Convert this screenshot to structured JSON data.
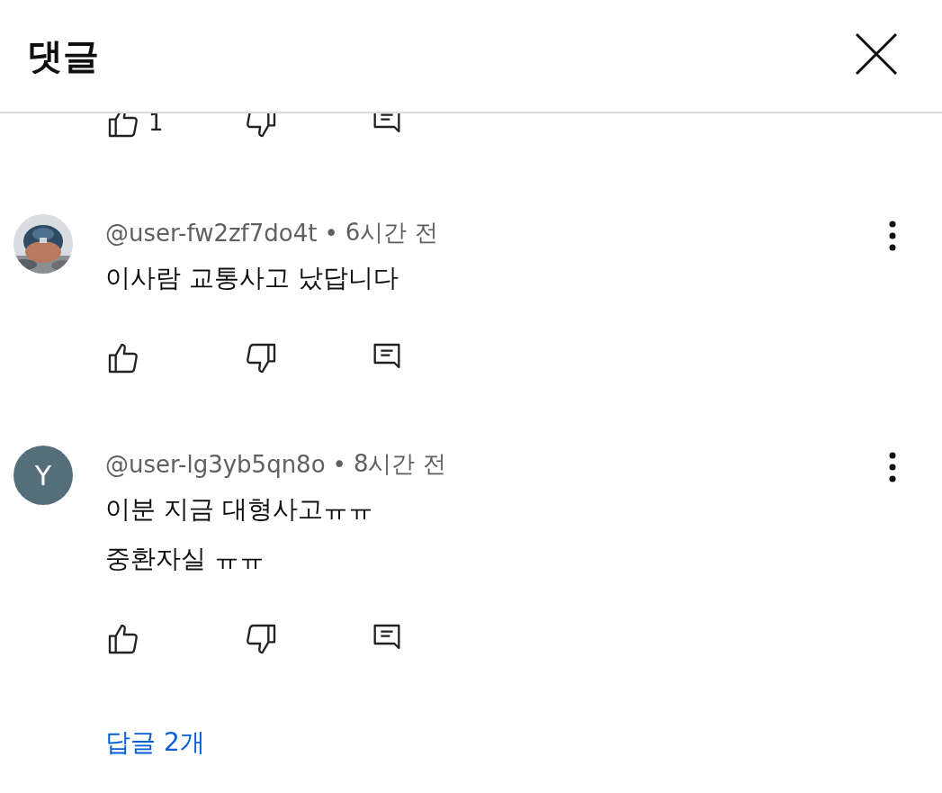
{
  "header": {
    "title": "댓글"
  },
  "cut_actions": {
    "like_count": "1"
  },
  "comments": [
    {
      "avatar": {
        "kind": "picture"
      },
      "author": "@user-fw2zf7do4t",
      "separator": "•",
      "time": "6시간 전",
      "lines": [
        "이사람 교통사고 났답니다"
      ]
    },
    {
      "avatar": {
        "kind": "letter",
        "letter": "Y"
      },
      "author": "@user-lg3yb5qn8o",
      "separator": "•",
      "time": "8시간 전",
      "lines": [
        "이분 지금 대형사고ㅠㅠ",
        "중환자실 ㅠㅠ"
      ],
      "replies": "답글 2개"
    }
  ]
}
